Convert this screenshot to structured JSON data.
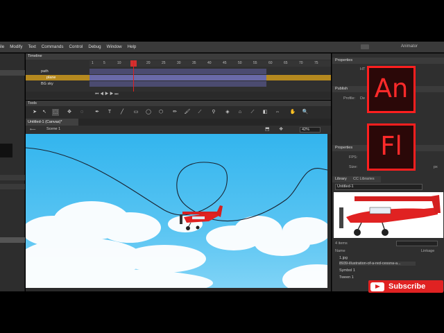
{
  "menu": [
    "Modify",
    "Text",
    "Commands",
    "Control",
    "Debug",
    "Window",
    "Help"
  ],
  "menu_partial": "ile",
  "workspace": "Animator",
  "timeline": {
    "title": "Timeline",
    "ruler": [
      "1",
      "5",
      "10",
      "15",
      "20",
      "25",
      "30",
      "35",
      "40",
      "45",
      "50",
      "55",
      "60",
      "65",
      "70",
      "75"
    ],
    "layers": [
      "path",
      "plane",
      "BG sky"
    ]
  },
  "tools": {
    "title": "Tools"
  },
  "document": {
    "tab": "Untitled-1 (Canvas)*",
    "scene": "Scene 1",
    "zoom": "42%"
  },
  "properties": {
    "title": "Properties",
    "publish": "Publish",
    "profile_label": "Profile:",
    "props_sub": "Properties",
    "fps_label": "FPS:",
    "size_label": "Size:",
    "unit": "px",
    "type_partial": "HT",
    "profile_partial": "De"
  },
  "library": {
    "tab1": "Library",
    "tab2": "CC Libraries",
    "file": "Untitled-1",
    "count": "4 items",
    "col_name": "Name",
    "col_linkage": "Linkage",
    "items": [
      "1.jpg",
      "8939-illustration-of-a-red-cessna-a...",
      "Symbol 1",
      "Tween 1"
    ]
  },
  "logos": {
    "animate": "An",
    "flash": "Fl"
  },
  "subscribe": "Subscribe",
  "colors": {
    "accent_red": "#e02222",
    "sky": "#33b5ee",
    "layer_highlight": "#b5891f"
  }
}
